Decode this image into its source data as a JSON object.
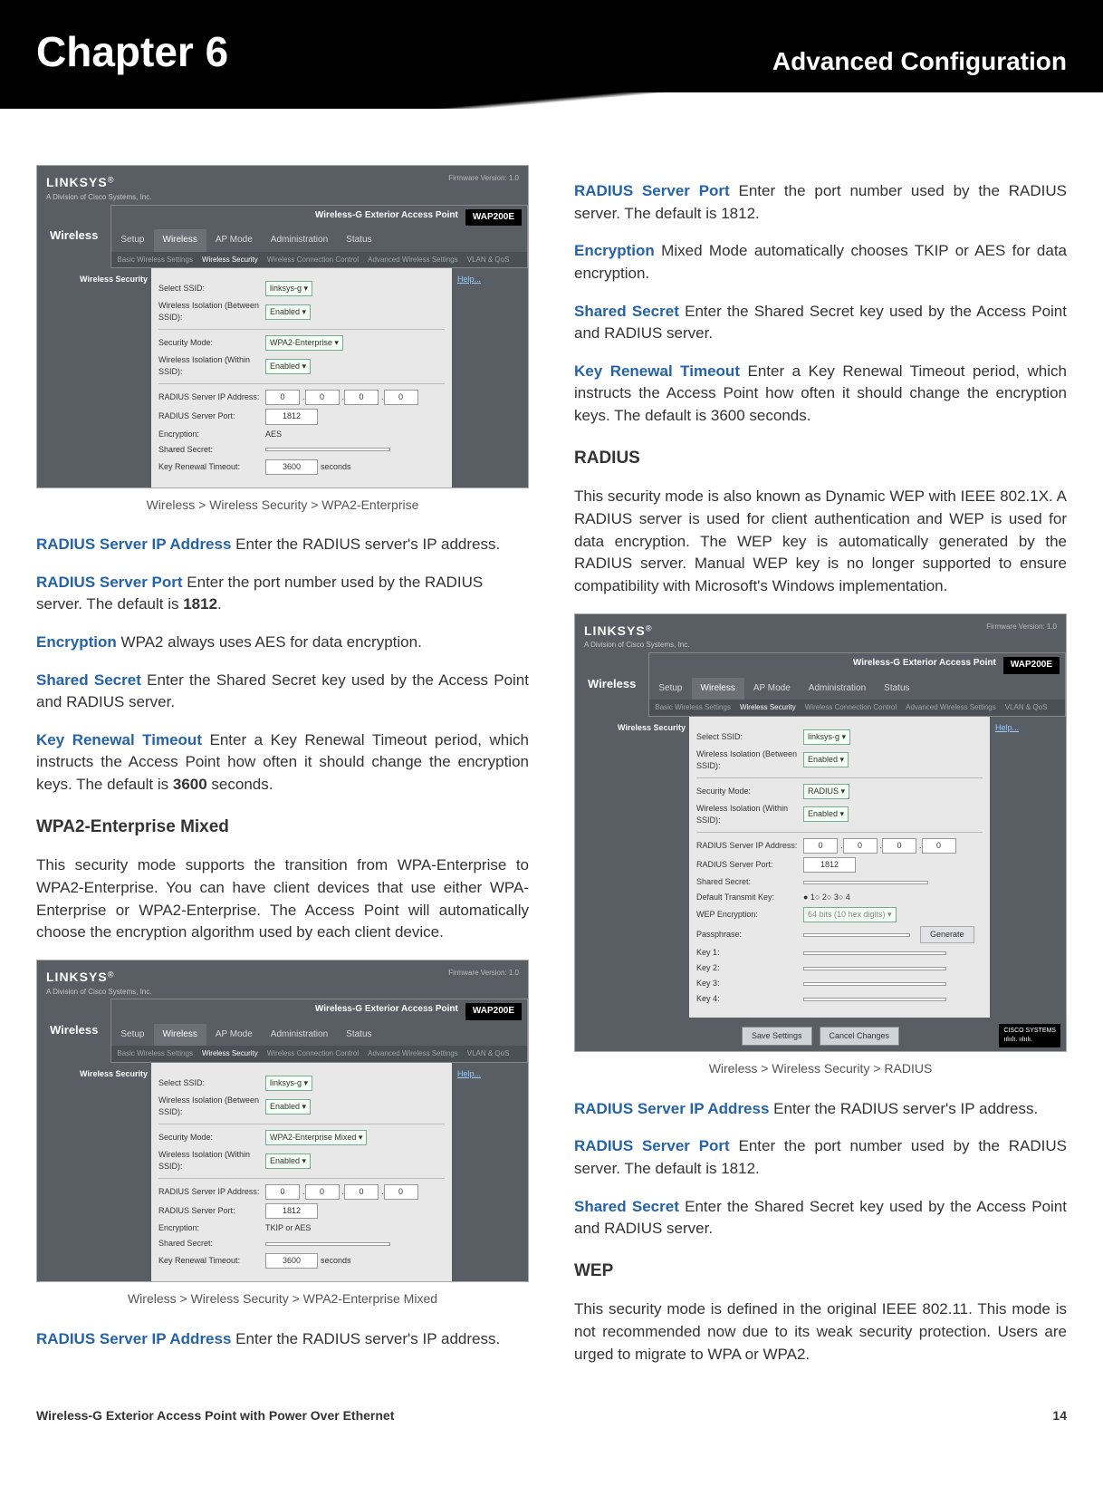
{
  "banner": {
    "left": "Chapter 6",
    "right": "Advanced Configuration"
  },
  "ui": {
    "brand": "LINKSYS",
    "brand_sub": "A Division of Cisco Systems, Inc.",
    "fw": "Firmware Version: 1.0",
    "product": "Wireless-G Exterior Access Point",
    "model": "WAP200E",
    "side": "Wireless",
    "tabs": {
      "setup": "Setup",
      "wireless": "Wireless",
      "apmode": "AP Mode",
      "admin": "Administration",
      "status": "Status"
    },
    "subtabs": {
      "a": "Basic Wireless Settings",
      "b": "Wireless Security",
      "c": "Wireless Connection Control",
      "d": "Advanced Wireless Settings",
      "e": "VLAN & QoS"
    },
    "nav": "Wireless Security",
    "help": "Help...",
    "labels": {
      "ssid": "Select SSID:",
      "iso1": "Wireless Isolation (Between SSID):",
      "mode": "Security Mode:",
      "iso2": "Wireless Isolation (Within SSID):",
      "rip": "RADIUS Server IP Address:",
      "rport": "RADIUS Server Port:",
      "enc": "Encryption:",
      "secret": "Shared Secret:",
      "renew": "Key Renewal Timeout:",
      "dtk": "Default Transmit Key:",
      "wepenc": "WEP Encryption:",
      "pass": "Passphrase:",
      "k1": "Key 1:",
      "k2": "Key 2:",
      "k3": "Key 3:",
      "k4": "Key 4:",
      "save": "Save Settings",
      "cancel": "Cancel Changes",
      "sec_unit": "seconds",
      "gen": "Generate"
    },
    "vals": {
      "ssid": "linksys-g ▾",
      "enabled": "Enabled ▾",
      "mode_wpa2": "WPA2-Enterprise     ▾",
      "mode_mixed": "WPA2-Enterprise Mixed ▾",
      "mode_radius": "RADIUS          ▾",
      "ip": "0",
      "port": "1812",
      "aes": "AES",
      "tkipaes": "TKIP or AES",
      "renew": "3600",
      "wepenc": "64 bits (10 hex digits) ▾",
      "dtk1": "○ 1",
      "dtk2": "○ 2",
      "dtk3": "○ 3",
      "dtk4": "○ 4",
      "dtk1s": "● 1"
    }
  },
  "cap1": "Wireless > Wireless Security > WPA2-Enterprise",
  "cap2": "Wireless > Wireless Security > WPA2-Enterprise Mixed",
  "cap3": "Wireless > Wireless Security > RADIUS",
  "txt": {
    "t1a": "RADIUS Server IP Address",
    "t1b": "  Enter the RADIUS server's IP address.",
    "t2a": "RADIUS Server Port",
    "t2b": "  Enter the port number used by the RADIUS server. The default is ",
    "t2c": "1812",
    "t2d": ".",
    "t3a": "Encryption",
    "t3b": "  WPA2 always uses AES for data encryption.",
    "t4a": "Shared Secret",
    "t4b": "  Enter the Shared Secret key used by the Access Point and RADIUS server.",
    "t5a": "Key Renewal Timeout",
    "t5b": " Enter a Key Renewal Timeout period, which instructs the Access Point how often it should change the encryption keys. The default is ",
    "t5c": "3600",
    "t5d": " seconds.",
    "h1": "WPA2-Enterprise Mixed",
    "p1": "This security mode supports the transition from WPA-Enterprise to WPA2-Enterprise. You can have client devices that use either WPA-Enterprise or WPA2-Enterprise. The Access Point will automatically choose the encryption algorithm used by each client device.",
    "r2a": "RADIUS Server Port",
    "r2b": "  Enter the port number used by the RADIUS server. The default is 1812.",
    "r3a": "Encryption",
    "r3b": "  Mixed Mode automatically chooses TKIP or AES for data encryption.",
    "h2": "RADIUS",
    "p2": "This security mode is also known as Dynamic WEP with IEEE 802.1X. A RADIUS server is used for client authentication and WEP is used for data encryption. The WEP key is automatically generated by the RADIUS server. Manual WEP key is no longer supported to ensure compatibility with Microsoft's Windows implementation.",
    "h3": "WEP",
    "p3": "This security mode is defined in the original IEEE 802.11. This mode is not recommended now due to its weak security protection. Users are urged to migrate to WPA or WPA2."
  },
  "footer": {
    "left": "Wireless-G Exterior Access Point with Power Over Ethernet",
    "right": "14"
  }
}
